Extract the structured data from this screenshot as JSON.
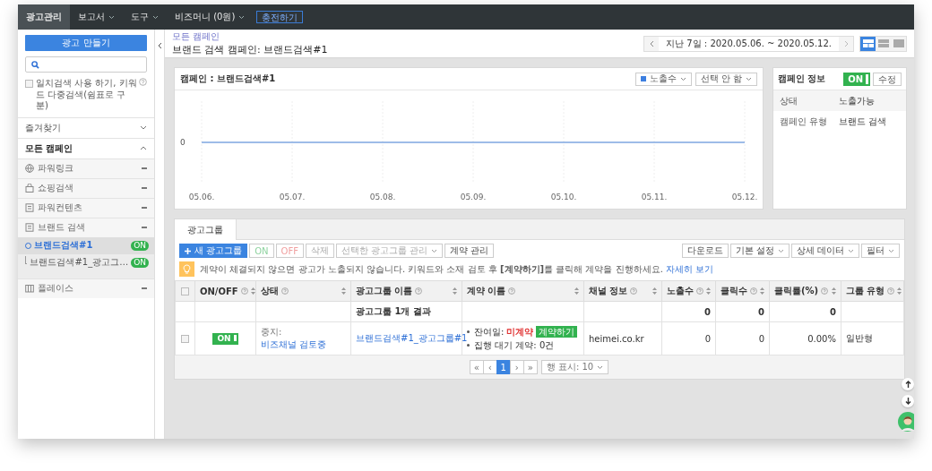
{
  "nav": {
    "items": [
      {
        "label": "광고관리",
        "selected": true,
        "dropdown": false
      },
      {
        "label": "보고서",
        "selected": false,
        "dropdown": true
      },
      {
        "label": "도구",
        "selected": false,
        "dropdown": true
      },
      {
        "label": "비즈머니 (0원)",
        "selected": false,
        "dropdown": true
      }
    ],
    "charge_button": "충전하기"
  },
  "sidebar": {
    "create_button": "광고 만들기",
    "exact_match": {
      "label": "일치검색 사용 하기, 키워드 다중검색(쉼표로 구분)",
      "checked": false
    },
    "sections": [
      {
        "label": "즐겨찾기",
        "expanded": false
      },
      {
        "label": "모든 캠페인",
        "expanded": true
      }
    ],
    "campaign_types": [
      {
        "label": "파워링크",
        "kind": "globe"
      },
      {
        "label": "쇼핑검색",
        "kind": "bag"
      },
      {
        "label": "파워컨텐츠",
        "kind": "doc"
      },
      {
        "label": "브랜드 검색",
        "kind": "brand",
        "children": [
          {
            "label": "브랜드검색#1",
            "selected": true,
            "status": "ON",
            "children": [
              {
                "label": "브랜드검색#1_광고그…",
                "selected": false,
                "status": "ON"
              }
            ]
          }
        ]
      },
      {
        "label": "플레이스",
        "kind": "place"
      }
    ]
  },
  "header": {
    "breadcrumb": "모든 캠페인",
    "title": "브랜드 검색 캠페인: 브랜드검색#1",
    "date_range": "지난 7일 : 2020.05.06. ~ 2020.05.12.",
    "view_modes": [
      {
        "kind": "split",
        "selected": true
      },
      {
        "kind": "rows",
        "selected": false
      },
      {
        "kind": "single",
        "selected": false
      }
    ]
  },
  "chart_panel": {
    "title": "캠페인 : 브랜드검색#1",
    "metric_select": {
      "label": "노출수",
      "color": "#3d7fe0"
    },
    "compare_select": "선택 안 함",
    "chart": {
      "y_label": "0",
      "x_labels": [
        "05.06.",
        "05.07.",
        "05.08.",
        "05.09.",
        "05.10.",
        "05.11.",
        "05.12."
      ]
    }
  },
  "info_panel": {
    "title": "캠페인 정보",
    "on": true,
    "toggle_label": "ON",
    "edit_button": "수정",
    "rows": [
      {
        "label": "상태",
        "value": "노출가능"
      },
      {
        "label": "캠페인 유형",
        "value": "브랜드 검색"
      }
    ]
  },
  "adgroups": {
    "tabs": [
      {
        "label": "광고그룹",
        "selected": true
      }
    ],
    "toolbar_left": [
      {
        "label": "새 광고그룹",
        "kind": "add",
        "disabled": false
      },
      {
        "label": "ON",
        "kind": "on",
        "disabled": true
      },
      {
        "label": "OFF",
        "kind": "off",
        "disabled": true
      },
      {
        "label": "삭제",
        "kind": "plain",
        "disabled": true
      },
      {
        "label": "선택한 광고그룹 관리",
        "kind": "dropdown",
        "disabled": true
      },
      {
        "label": "계약 관리",
        "kind": "plain",
        "disabled": false
      }
    ],
    "toolbar_right": [
      {
        "label": "다운로드",
        "kind": "plain",
        "disabled": false
      },
      {
        "label": "기본 설정",
        "kind": "dropdown",
        "disabled": false
      },
      {
        "label": "상세 데이터",
        "kind": "dropdown",
        "disabled": false
      },
      {
        "label": "필터",
        "kind": "dropdown",
        "disabled": false
      }
    ],
    "tip": {
      "text": "계약이 체결되지 않으면 광고가 노출되지 않습니다. 키워드와 소재 검토 후 **[계약하기]**를 클릭해 계약을 진행하세요.",
      "link": "자세히 보기"
    },
    "select_all": {
      "checked": false
    },
    "columns": [
      "ON/OFF",
      "상태",
      "광고그룹 이름",
      "계약 이름",
      "채널 정보",
      "노출수",
      "클릭수",
      "클릭률(%)",
      "그룹 유형"
    ],
    "summary": {
      "label": "광고그룹 1개 결과",
      "impressions": "0",
      "clicks": "0",
      "ctr": "0"
    },
    "rows": [
      {
        "checked": false,
        "on": true,
        "toggle_label": "ON",
        "status_prefix": "중지:",
        "status": "비즈채널 검토중",
        "name": "브랜드검색#1_광고그룹#1",
        "contract": {
          "days_label": "잔여일:",
          "state": "미계약",
          "action": "계약하기",
          "pending": "집행 대기 계약: 0건"
        },
        "channel": "heimei.co.kr",
        "impressions": "0",
        "clicks": "0",
        "ctr": "0.00%",
        "group_type": "일반형"
      }
    ],
    "pagination": {
      "before": [
        "«",
        "‹"
      ],
      "pages": [
        {
          "label": "1",
          "selected": true
        }
      ],
      "after": [
        "›",
        "»"
      ],
      "rows_select": "행 표시: 10"
    }
  }
}
